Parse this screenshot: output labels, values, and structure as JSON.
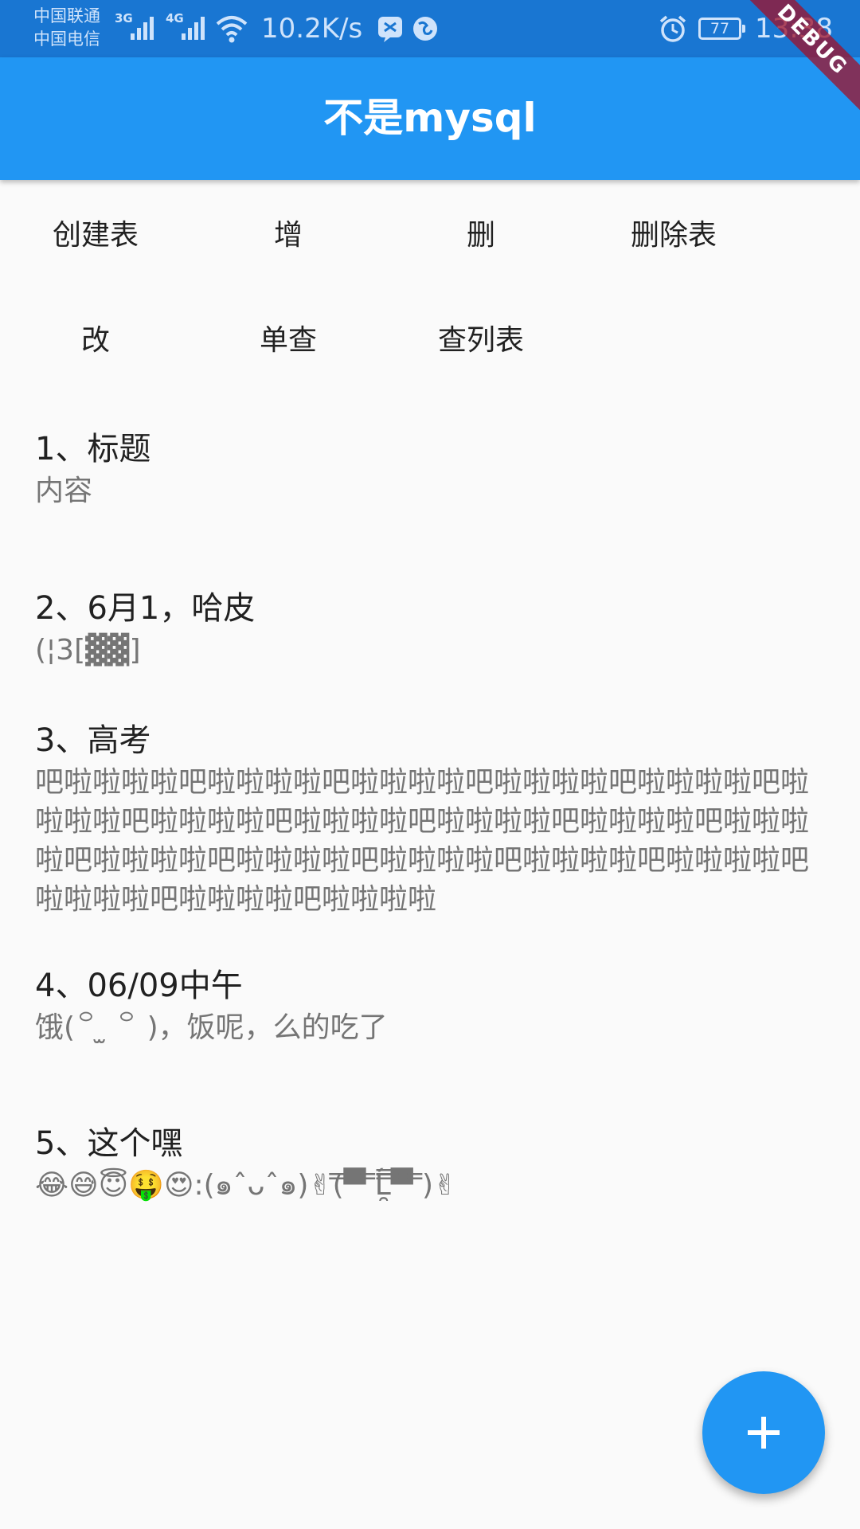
{
  "status_bar": {
    "carrier_1": "中国联通",
    "carrier_2": "中国电信",
    "signal_1_type": "3G",
    "signal_2_type": "4G",
    "net_speed": "10.2K/s",
    "battery_level": "77",
    "time": "13:38",
    "icons": [
      "signal-icon",
      "wifi-icon",
      "app-notification-icon",
      "browser-icon",
      "alarm-icon",
      "battery-icon"
    ]
  },
  "debug_banner": "DEBUG",
  "app_bar": {
    "title": "不是mysql",
    "color": "#2196f3"
  },
  "actions": {
    "create_table": "创建表",
    "insert": "增",
    "delete": "删",
    "drop_table": "删除表",
    "update": "改",
    "query_one": "单查",
    "query_list": "查列表"
  },
  "records": [
    {
      "title": "1、标题",
      "content": "内容"
    },
    {
      "title": "2、6月1，哈皮",
      "content": "(¦3[▓▓]"
    },
    {
      "title": "3、高考",
      "content": "吧啦啦啦啦吧啦啦啦啦吧啦啦啦啦吧啦啦啦啦吧啦啦啦啦吧啦啦啦啦吧啦啦啦啦吧啦啦啦啦吧啦啦啦啦吧啦啦啦啦吧啦啦啦啦吧啦啦啦啦吧啦啦啦啦吧啦啦啦啦吧啦啦啦啦吧啦啦啦啦吧啦啦啦啦吧啦啦啦啦吧啦啦啦啦"
    },
    {
      "title": "4、06/09中午",
      "content": "饿(꒪ ̫ ꒪ )，饭呢，么的吃了"
    },
    {
      "title": "5、这个嘿",
      "content": "😂😅😇🤑😍:(๑ˆᴗˆ๑)✌(̿▀̿ ̿Ĺ̯̿̿▀̿ ̿)✌"
    }
  ],
  "fab": {
    "icon": "plus-icon",
    "color": "#2196f3"
  }
}
